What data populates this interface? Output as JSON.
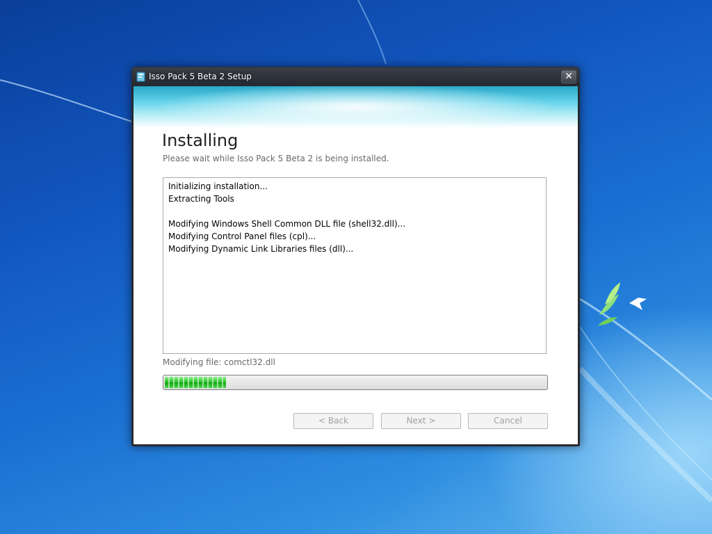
{
  "window": {
    "title": "Isso Pack 5 Beta 2 Setup",
    "close_label": "✕"
  },
  "page": {
    "heading": "Installing",
    "subheading": "Please wait while Isso Pack 5 Beta 2 is being installed."
  },
  "log": {
    "lines": [
      "Initializing installation...",
      "Extracting Tools",
      "",
      "Modifying Windows Shell Common DLL file (shell32.dll)...",
      "Modifying Control Panel files (cpl)...",
      "Modifying Dynamic Link Libraries files (dll)..."
    ]
  },
  "status": {
    "text": "Modifying file: comctl32.dll"
  },
  "progress": {
    "fraction": 0.16
  },
  "buttons": {
    "back": "< Back",
    "next": "Next >",
    "cancel": "Cancel"
  },
  "colors": {
    "progress_green": "#2ec22e",
    "title_bar": "#23272e",
    "desktop_blue": "#1a6fd2"
  },
  "icons": {
    "app": "installer-package-icon",
    "close": "close-icon",
    "desktop_logo": "windows-logo-icon"
  }
}
